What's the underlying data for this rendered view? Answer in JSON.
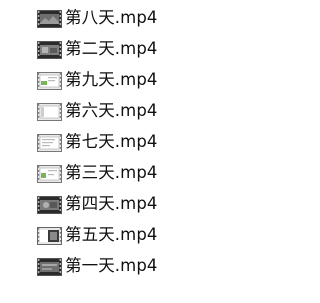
{
  "files": [
    {
      "name": "第八天.mp4",
      "thumbnail": "dark-video-thumbnail-icon"
    },
    {
      "name": "第二天.mp4",
      "thumbnail": "dark-video-thumbnail-icon"
    },
    {
      "name": "第九天.mp4",
      "thumbnail": "light-video-thumbnail-icon"
    },
    {
      "name": "第六天.mp4",
      "thumbnail": "light-video-thumbnail-icon"
    },
    {
      "name": "第七天.mp4",
      "thumbnail": "light-video-thumbnail-icon"
    },
    {
      "name": "第三天.mp4",
      "thumbnail": "light-video-thumbnail-icon"
    },
    {
      "name": "第四天.mp4",
      "thumbnail": "dark-video-thumbnail-icon"
    },
    {
      "name": "第五天.mp4",
      "thumbnail": "mixed-video-thumbnail-icon"
    },
    {
      "name": "第一天.mp4",
      "thumbnail": "dark-video-thumbnail-icon"
    }
  ],
  "colors": {
    "text": "#111111",
    "film_dark": "#2b2b2b",
    "film_light": "#e8e8e8",
    "screen_green": "#7ab35a"
  }
}
